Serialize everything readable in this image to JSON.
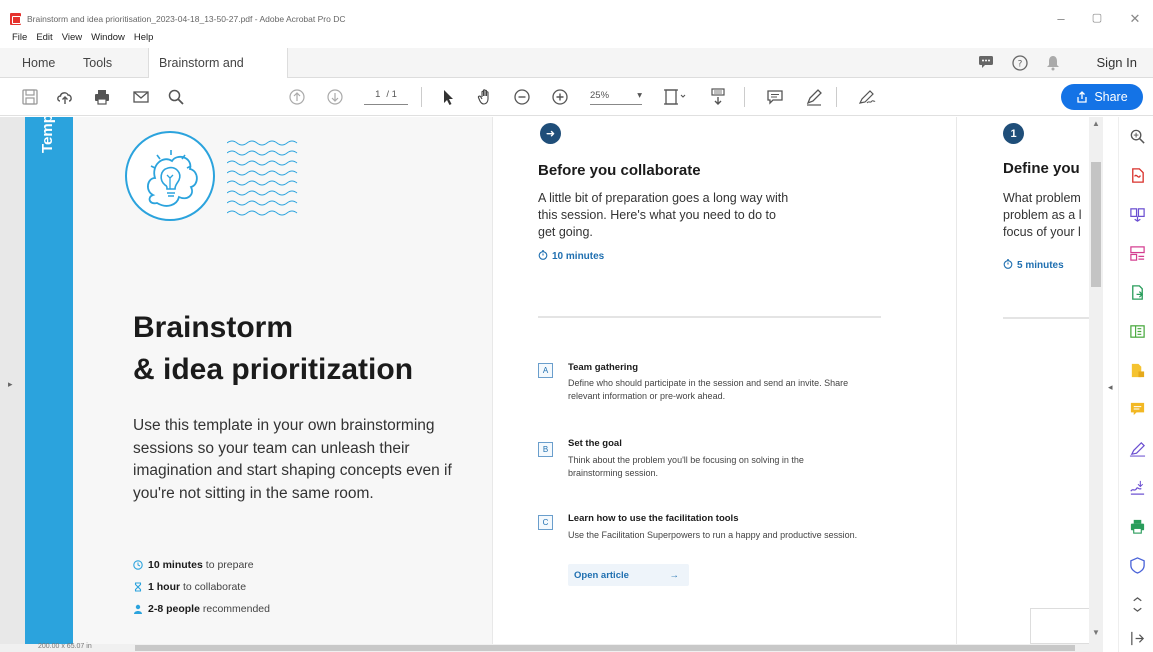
{
  "window": {
    "title": "Brainstorm and idea prioritisation_2023-04-18_13-50-27.pdf - Adobe Acrobat Pro DC",
    "minimize": "–",
    "restore": "▢",
    "close": "✕"
  },
  "menu": [
    "File",
    "Edit",
    "View",
    "Window",
    "Help"
  ],
  "tabs": {
    "home": "Home",
    "tools": "Tools",
    "document": "Brainstorm and ide...",
    "close": "×",
    "sign_in": "Sign In"
  },
  "toolbar": {
    "page_current": "1",
    "page_total": "/ 1",
    "zoom": "25%",
    "zoom_caret": "▾",
    "share_label": "Share"
  },
  "page1": {
    "sidebar_text": "Temp",
    "title_line1": "Brainstorm",
    "title_line2": "& idea prioritization",
    "description": "Use this template in your own brainstorming sessions so your team can unleash their imagination and start shaping concepts even if you're not sitting in the same room.",
    "stats": [
      {
        "bold": "10 minutes",
        "rest": " to prepare",
        "icon": "clock-icon"
      },
      {
        "bold": "1 hour",
        "rest": " to collaborate",
        "icon": "hourglass-icon"
      },
      {
        "bold": "2-8 people",
        "rest": " recommended",
        "icon": "person-icon"
      }
    ]
  },
  "page2": {
    "step": "➜",
    "title": "Before you collaborate",
    "description": "A little bit of preparation goes a long way with this session. Here's what you need to do to get going.",
    "minutes": "10 minutes",
    "items": [
      {
        "letter": "A",
        "title": "Team gathering",
        "desc": "Define who should participate in the session and send an invite. Share relevant information or pre-work ahead."
      },
      {
        "letter": "B",
        "title": "Set the goal",
        "desc": "Think about the problem you'll be focusing on solving in the brainstorming session."
      },
      {
        "letter": "C",
        "title": "Learn how to use the facilitation tools",
        "desc": "Use the Facilitation Superpowers to run a happy and productive session."
      }
    ],
    "open_article": "Open article",
    "open_article_arrow": "→"
  },
  "page3": {
    "step": "1",
    "title": "Define you",
    "desc_lines": [
      "What problem",
      "problem as a l",
      "focus of your l"
    ],
    "minutes": "5 minutes"
  },
  "status": {
    "coords": "200.00 x 65.07 in"
  },
  "colors": {
    "accent": "#1473e6",
    "teal": "#2ba3dd",
    "navy": "#1f4e79"
  }
}
